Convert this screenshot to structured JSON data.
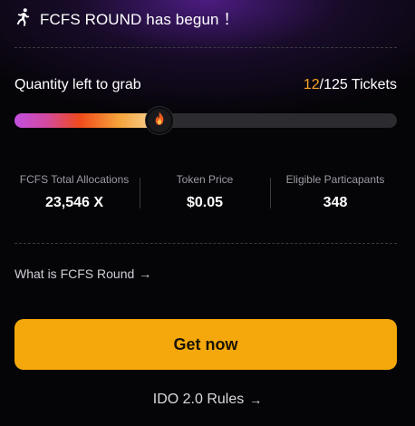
{
  "banner": {
    "icon": "running-person-icon",
    "text": "FCFS ROUND has begun ！"
  },
  "quantity": {
    "label": "Quantity left to grab",
    "remaining": "12",
    "total_suffix": "/125 Tickets",
    "progress_fraction": 0.38
  },
  "stats": [
    {
      "label": "FCFS Total Allocations",
      "value": "23,546 X"
    },
    {
      "label": "Token Price",
      "value": "$0.05"
    },
    {
      "label": "Eligible Particapants",
      "value": "348"
    }
  ],
  "links": {
    "what_is": "What is FCFS Round",
    "rules": "IDO 2.0 Rules"
  },
  "actions": {
    "get_now": "Get now"
  },
  "colors": {
    "accent": "#f5a80b",
    "remaining_highlight": "#f5a623",
    "background": "#050407",
    "track": "#2b2b30"
  },
  "icons": {
    "thumb": "fire-icon",
    "arrow": "arrow-right-icon"
  }
}
